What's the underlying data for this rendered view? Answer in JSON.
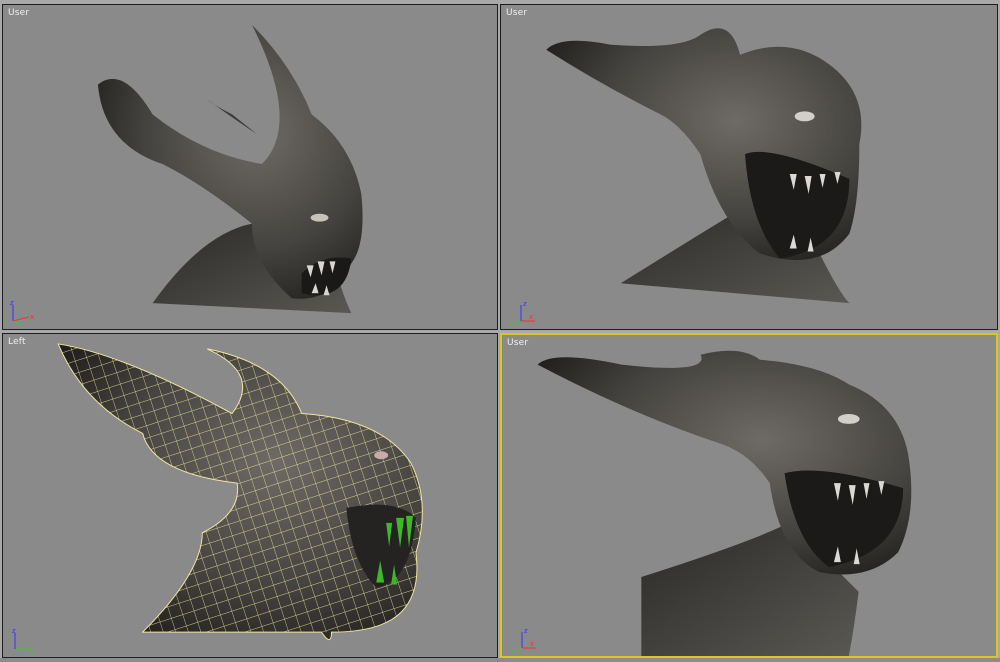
{
  "viewports": [
    {
      "label": "User",
      "active": false
    },
    {
      "label": "User",
      "active": false
    },
    {
      "label": "Left",
      "active": false
    },
    {
      "label": "User",
      "active": true
    }
  ],
  "axis": {
    "x": "x",
    "y": "y",
    "z": "z"
  },
  "colors": {
    "viewport_bg": "#8a8a8a",
    "active_border": "#d8c81e",
    "wire": "#f2e6a0",
    "teeth_sel": "#3db82a"
  }
}
